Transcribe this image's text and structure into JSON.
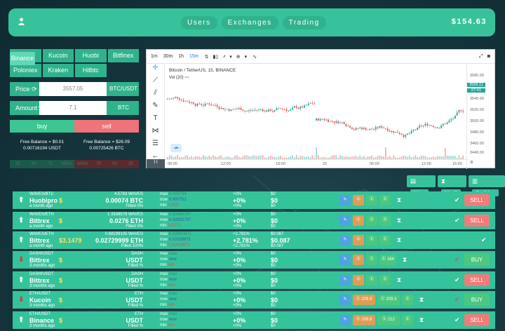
{
  "header": {
    "nav": [
      "Users",
      "Exchanges",
      "Trading"
    ],
    "balance": "$154.63"
  },
  "exchanges": {
    "row1": [
      "Binance",
      "Bittrex",
      "Kucoin",
      "Huobi"
    ],
    "row2": [
      "Bitfinex",
      "Poloniex",
      "Kraken",
      "Hitbtc"
    ]
  },
  "order": {
    "price_label": "Price",
    "price_value": "3557.05",
    "pair": "BTC/USDT",
    "amount_label": "Amount:",
    "amount_value": "7.1",
    "amount_unit": "BTC",
    "buy": "buy",
    "sell": "sell",
    "free_left_1": "Free Balance = $0.01",
    "free_left_2": "0.00716194 USDT",
    "free_right_1": "Free Balance = $26.09",
    "free_right_2": "0.00725426 BTC",
    "pct_buy": [
      "25",
      "50",
      "75",
      "100%"
    ],
    "pct_sell": [
      "100%",
      "75",
      "50",
      "25"
    ]
  },
  "chart": {
    "intervals": [
      "1m",
      "30m",
      "1h",
      "15m"
    ],
    "title": "Bitcoin / TetherUS, 15, BINANCE",
    "vol": "Vol (20)",
    "y_ticks": [
      "3580.00",
      "3560.00",
      "3540.00",
      "3520.00",
      "3500.00",
      "3480.00",
      "3460.00",
      "3440.00"
    ],
    "price_tag": "3559.11",
    "price_tag2": "07:41",
    "x_ticks": [
      "06:00",
      "12:00",
      "18:00",
      "22",
      "06:00",
      "12:00",
      "16:00"
    ]
  },
  "archive": {
    "live": "Live",
    "hodl": "Hodl",
    "archive": "Archive"
  },
  "trades": [
    {
      "pair": "WAVES/BTC",
      "exchange": "Huobipro",
      "ago": "a month ago",
      "profit": "",
      "dir": "up",
      "amount": "4.5783 WAVES",
      "price": "0.00074 BTC",
      "filled": "Filled 0%",
      "max": "0.000764",
      "now": "0.000751",
      "min": "0.000",
      "p1": "+0%",
      "p2": "+0%",
      "p3": "+0%",
      "d1": "$0",
      "d2": "$0",
      "d3": "$0",
      "btns": [
        "",
        "",
        ""
      ],
      "action": "SELL"
    },
    {
      "pair": "WAVES/ETH",
      "exchange": "Bittrex",
      "ago": "a month ago",
      "profit": "",
      "dir": "up",
      "amount": "1.3338579 WAVES",
      "price": "0.0276 ETH",
      "filled": "Filled 0%",
      "max": "0.02852767",
      "now": "0.02802767",
      "min": "0.0271",
      "p1": "+0%",
      "p2": "+0%",
      "p3": "+0%",
      "d1": "$0",
      "d2": "$0",
      "d3": "$0",
      "btns": [
        "",
        "",
        ""
      ],
      "action": "SELL"
    },
    {
      "pair": "WAVES/ETH",
      "exchange": "Bittrex",
      "ago": "a month ago",
      "profit": "$3.1479",
      "dir": "up",
      "amount": "0.88199105 WAVES",
      "price": "0.02729999 ETH",
      "filled": "Filled 100%",
      "max": "0.02800871",
      "now": "0.02028671",
      "min": "0.02028671",
      "p1": "+2.781%",
      "p2": "+2.781%",
      "p3": "+2.781%",
      "d1": "$0.087",
      "d2": "$0.087",
      "d3": "$0.087",
      "btns": [
        "",
        "",
        ""
      ],
      "action": ""
    },
    {
      "pair": "DASH/USDT",
      "exchange": "Bittrex",
      "ago": "3 months ago",
      "profit": "",
      "dir": "down",
      "amount": "DASH",
      "price": "USDT",
      "filled": "Filled %",
      "max": "max",
      "now": "now",
      "min": "min",
      "p1": "+0%",
      "p2": "+0%",
      "p3": "+0%",
      "d1": "$0",
      "d2": "$0",
      "d3": "$0",
      "btns": [
        "",
        "",
        "184"
      ],
      "action": "BUY"
    },
    {
      "pair": "DASH/USDT",
      "exchange": "Bittrex",
      "ago": "3 months ago",
      "profit": "",
      "dir": "up",
      "amount": "DASH",
      "price": "USDT",
      "filled": "Filled %",
      "max": "max",
      "now": "now",
      "min": "min",
      "p1": "+0%",
      "p2": "+0%",
      "p3": "+0%",
      "d1": "$0",
      "d2": "$0",
      "d3": "$0",
      "btns": [
        "",
        "",
        ""
      ],
      "action": "SELL"
    },
    {
      "pair": "ETH/USDT",
      "exchange": "Kucoin",
      "ago": "3 months ago",
      "profit": "",
      "dir": "down",
      "amount": "ETH",
      "price": "USDT",
      "filled": "Filled %",
      "max": "max",
      "now": "now",
      "min": "min",
      "p1": "+0%",
      "p2": "+0%",
      "p3": "+0%",
      "d1": "$0",
      "d2": "$0",
      "d3": "$0",
      "btns": [
        "209.9",
        "209.3",
        ""
      ],
      "action": "BUY"
    },
    {
      "pair": "ETH/USDT",
      "exchange": "Binance",
      "ago": "3 months ago",
      "profit": "",
      "dir": "up",
      "amount": "ETH",
      "price": "USDT",
      "filled": "Filled %",
      "max": "max",
      "now": "now",
      "min": "min",
      "p1": "+0%",
      "p2": "+0%",
      "p3": "+0%",
      "d1": "$0",
      "d2": "$0",
      "d3": "$0",
      "btns": [
        "209.8",
        "212",
        ""
      ],
      "action": "SELL"
    }
  ]
}
